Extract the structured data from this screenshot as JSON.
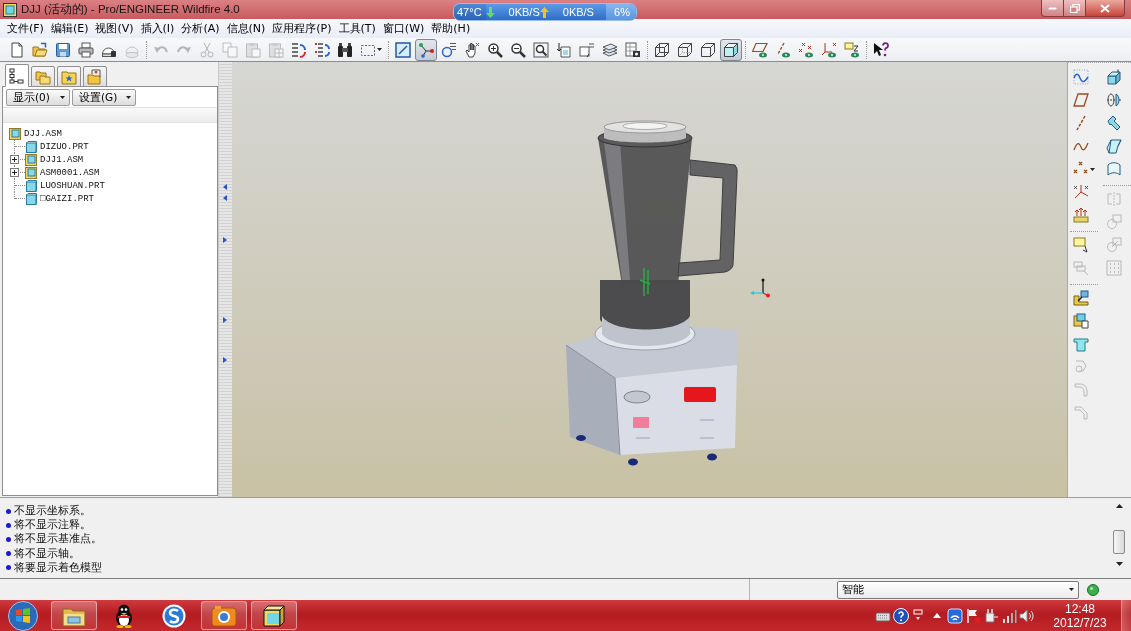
{
  "window": {
    "title": "DJJ (活动的) - Pro/ENGINEER Wildfire 4.0"
  },
  "network_monitor": {
    "temperature": "47°C",
    "download_speed": "0KB/S",
    "upload_speed": "0KB/S",
    "cpu_usage": "6%"
  },
  "menu": [
    "文件(F)",
    "编辑(E)",
    "视图(V)",
    "插入(I)",
    "分析(A)",
    "信息(N)",
    "应用程序(P)",
    "工具(T)",
    "窗口(W)",
    "帮助(H)"
  ],
  "toolbar": {
    "groups": [
      {
        "buttons": [
          {
            "on": false,
            "disabled": false
          },
          {
            "on": false,
            "disabled": false
          },
          {
            "on": false,
            "disabled": false
          },
          {
            "on": false,
            "disabled": false
          },
          {
            "on": false,
            "disabled": false
          },
          {
            "on": false,
            "disabled": true
          }
        ]
      },
      {
        "buttons": [
          {
            "on": false,
            "disabled": true
          },
          {
            "on": false,
            "disabled": true
          },
          {
            "on": false,
            "disabled": true
          },
          {
            "on": false,
            "disabled": true
          },
          {
            "on": false,
            "disabled": true
          },
          {
            "on": false,
            "disabled": true
          },
          {
            "on": false,
            "disabled": false
          },
          {
            "on": false,
            "disabled": false
          },
          {
            "on": false,
            "disabled": false
          },
          {
            "on": false,
            "disabled": false
          }
        ]
      },
      {
        "buttons": [
          {
            "on": false,
            "disabled": false
          },
          {
            "on": true,
            "disabled": false
          },
          {
            "on": false,
            "disabled": false
          },
          {
            "on": false,
            "disabled": false
          },
          {
            "on": false,
            "disabled": false
          },
          {
            "on": false,
            "disabled": false
          },
          {
            "on": false,
            "disabled": false
          },
          {
            "on": false,
            "disabled": false
          },
          {
            "on": false,
            "disabled": false
          },
          {
            "on": false,
            "disabled": false
          },
          {
            "on": false,
            "disabled": false
          }
        ]
      },
      {
        "buttons": [
          {
            "on": false,
            "disabled": false
          },
          {
            "on": false,
            "disabled": false
          },
          {
            "on": false,
            "disabled": false
          },
          {
            "on": true,
            "disabled": false
          }
        ]
      },
      {
        "buttons": [
          {
            "on": false,
            "disabled": false
          },
          {
            "on": false,
            "disabled": false
          },
          {
            "on": false,
            "disabled": false
          },
          {
            "on": false,
            "disabled": false
          },
          {
            "on": false,
            "disabled": false
          }
        ]
      },
      {
        "buttons": [
          {
            "on": false,
            "disabled": false
          }
        ]
      }
    ]
  },
  "navigator": {
    "tabs": [
      {
        "selected": true
      },
      {
        "selected": false
      },
      {
        "selected": false
      },
      {
        "selected": false
      }
    ],
    "buttons": [
      "显示(0)",
      "设置(G)"
    ],
    "tree": [
      {
        "label": "DJJ.ASM",
        "kind": "assembly",
        "children": [
          {
            "label": "DIZUO.PRT",
            "kind": "part"
          },
          {
            "label": "DJJ1.ASM",
            "kind": "assembly",
            "expanded": false
          },
          {
            "label": "ASM0001.ASM",
            "kind": "assembly",
            "expanded": false
          },
          {
            "label": "LUOSHUAN.PRT",
            "kind": "part"
          },
          {
            "label": "□GAIZI.PRT",
            "kind": "part"
          }
        ]
      }
    ]
  },
  "feature_toolbar": {
    "columns": [
      {
        "groups": [
          {
            "buttons": [
              {
                "disabled": false
              },
              {
                "disabled": false
              },
              {
                "disabled": false
              },
              {
                "disabled": false
              },
              {
                "disabled": false
              },
              {
                "disabled": false
              },
              {
                "disabled": false
              }
            ]
          },
          {
            "buttons": [
              {
                "disabled": false
              },
              {
                "disabled": true
              }
            ]
          },
          {
            "buttons": [
              {
                "disabled": false
              },
              {
                "disabled": false
              },
              {
                "disabled": false
              },
              {
                "disabled": true
              },
              {
                "disabled": true
              },
              {
                "disabled": true
              }
            ]
          }
        ]
      },
      {
        "groups": [
          {
            "buttons": [
              {
                "disabled": false
              },
              {
                "disabled": false
              },
              {
                "disabled": false
              },
              {
                "disabled": false
              },
              {
                "disabled": false
              }
            ]
          },
          {
            "buttons": [
              {
                "disabled": true
              },
              {
                "disabled": true
              },
              {
                "disabled": true
              },
              {
                "disabled": true
              }
            ]
          }
        ]
      }
    ]
  },
  "messages": [
    "不显示坐标系。",
    "将不显示注释。",
    "将不显示基准点。",
    "将不显示轴。",
    "将要显示着色模型"
  ],
  "status_bar": {
    "filter": "智能"
  },
  "taskbar": {
    "apps": [
      {
        "running": true
      },
      {
        "running": false
      },
      {
        "running": false
      },
      {
        "running": true
      },
      {
        "running": true
      }
    ],
    "time": "12:48",
    "date": "2012/7/23"
  }
}
